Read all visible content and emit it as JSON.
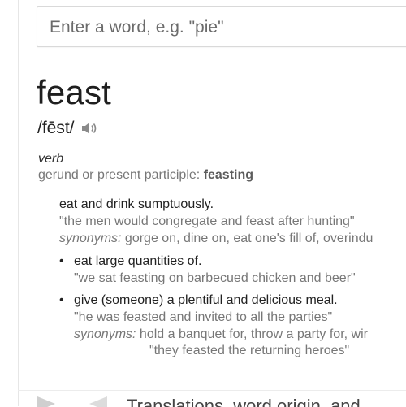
{
  "search": {
    "placeholder": "Enter a word, e.g. \"pie\""
  },
  "entry": {
    "word": "feast",
    "phonetic": "/fēst/",
    "part_of_speech": "verb",
    "forms_label": "gerund or present participle: ",
    "forms_value": "feasting"
  },
  "senses": [
    {
      "definition": "eat and drink sumptuously.",
      "example": "\"the men would congregate and feast after hunting\"",
      "synonyms_label": "synonyms:",
      "synonyms": " gorge on, dine on, eat one's fill of, overindu"
    },
    {
      "bullet": "•",
      "definition": "eat large quantities of.",
      "example": "\"we sat feasting on barbecued chicken and beer\""
    },
    {
      "bullet": "•",
      "definition": "give (someone) a plentiful and delicious meal.",
      "example": "\"he was feasted and invited to all the parties\"",
      "synonyms_label": "synonyms:",
      "synonyms": " hold a banquet for, throw a party for, wir",
      "example2": "\"they feasted the returning heroes\""
    }
  ],
  "footer": {
    "text": "Translations, word origin, and"
  },
  "icons": {
    "speaker": "speaker-icon",
    "prev": "prev-arrow-icon",
    "next": "next-arrow-icon"
  }
}
